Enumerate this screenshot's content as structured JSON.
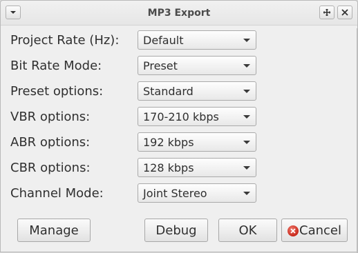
{
  "window": {
    "title": "MP3 Export"
  },
  "titlebar": {
    "menu_icon": "chevron-down-icon",
    "maximize_icon": "plus-icon",
    "close_icon": "close-icon"
  },
  "form": {
    "rows": [
      {
        "label": "Project Rate (Hz):",
        "value": "Default"
      },
      {
        "label": "Bit Rate Mode:",
        "value": "Preset"
      },
      {
        "label": "Preset options:",
        "value": "Standard"
      },
      {
        "label": "VBR options:",
        "value": "170-210 kbps"
      },
      {
        "label": "ABR options:",
        "value": "192 kbps"
      },
      {
        "label": "CBR options:",
        "value": "128 kbps"
      },
      {
        "label": "Channel Mode:",
        "value": "Joint Stereo"
      }
    ]
  },
  "buttons": {
    "manage": "Manage",
    "debug": "Debug",
    "ok": "OK",
    "cancel": "Cancel"
  },
  "colors": {
    "cancel_icon": "#d63a2c",
    "window_bg": "#efefef"
  }
}
